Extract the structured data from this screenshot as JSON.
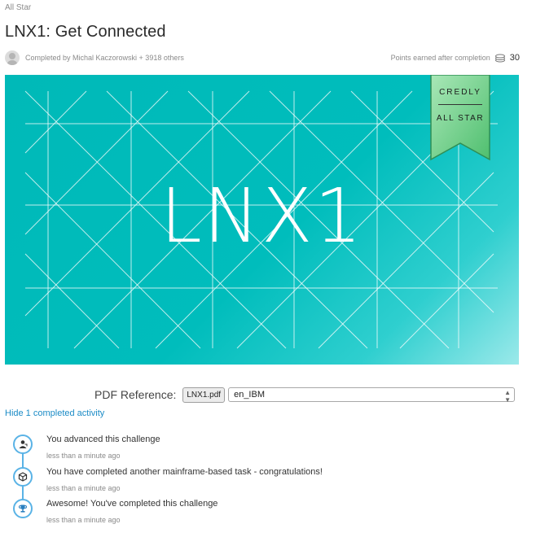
{
  "breadcrumb": "All Star",
  "title": "LNX1: Get Connected",
  "meta": {
    "completed_by": "Completed by Michal Kaczorowski + 3918 others",
    "points_label": "Points earned after completion",
    "points_value": "30"
  },
  "banner": {
    "text": "LNX1",
    "ribbon_line1": "CREDLY",
    "ribbon_line2": "ALL STAR",
    "colors": {
      "teal": "#00b9b8",
      "ribbon": "#5cc48a"
    }
  },
  "pdf": {
    "label": "PDF Reference:",
    "file": "LNX1.pdf",
    "language": "en_IBM"
  },
  "hide_link": "Hide 1 completed activity",
  "activities": [
    {
      "icon": "user-advance-icon",
      "text": "You advanced this challenge",
      "time": "less than a minute ago"
    },
    {
      "icon": "cube-icon",
      "text": "You have completed another mainframe-based task - congratulations!",
      "time": "less than a minute ago"
    },
    {
      "icon": "trophy-icon",
      "text": "Awesome! You've completed this challenge",
      "time": "less than a minute ago"
    }
  ]
}
